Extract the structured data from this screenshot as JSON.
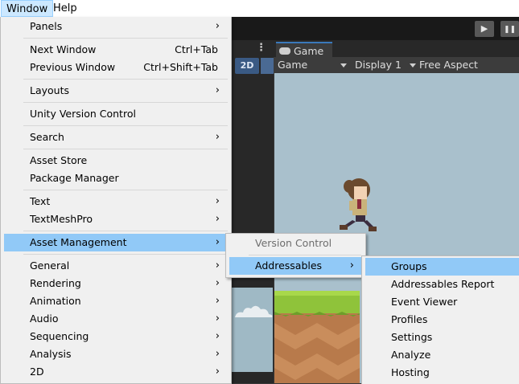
{
  "menubar": {
    "window": "Window",
    "help": "Help"
  },
  "toolbar": {
    "play_icon": "play-icon",
    "pause_icon": "pause-icon"
  },
  "scene": {
    "mode_2d": "2D"
  },
  "game": {
    "tab_label": "Game",
    "view_dropdown": "Game",
    "display_dropdown": "Display 1",
    "aspect_dropdown": "Free Aspect"
  },
  "window_menu": {
    "items": [
      {
        "label": "Panels",
        "submenu": true
      },
      {
        "label": "Next Window",
        "shortcut": "Ctrl+Tab"
      },
      {
        "label": "Previous Window",
        "shortcut": "Ctrl+Shift+Tab"
      },
      {
        "label": "Layouts",
        "submenu": true
      },
      {
        "label": "Unity Version Control"
      },
      {
        "label": "Search",
        "submenu": true
      },
      {
        "label": "Asset Store"
      },
      {
        "label": "Package Manager"
      },
      {
        "label": "Text",
        "submenu": true
      },
      {
        "label": "TextMeshPro",
        "submenu": true
      },
      {
        "label": "Asset Management",
        "submenu": true,
        "highlighted": true
      },
      {
        "label": "General",
        "submenu": true
      },
      {
        "label": "Rendering",
        "submenu": true
      },
      {
        "label": "Animation",
        "submenu": true
      },
      {
        "label": "Audio",
        "submenu": true
      },
      {
        "label": "Sequencing",
        "submenu": true
      },
      {
        "label": "Analysis",
        "submenu": true
      },
      {
        "label": "2D",
        "submenu": true
      }
    ]
  },
  "asset_management_menu": {
    "items": [
      {
        "label": "Version Control",
        "disabled": true
      },
      {
        "label": "Addressables",
        "submenu": true,
        "highlighted": true
      }
    ]
  },
  "addressables_menu": {
    "items": [
      {
        "label": "Groups",
        "highlighted": true
      },
      {
        "label": "Addressables Report"
      },
      {
        "label": "Event Viewer"
      },
      {
        "label": "Profiles"
      },
      {
        "label": "Settings"
      },
      {
        "label": "Analyze"
      },
      {
        "label": "Hosting"
      }
    ]
  },
  "glyphs": {
    "submenu_arrow": "›",
    "kebab": "⋮",
    "play": "▶",
    "pause": "❚❚"
  }
}
